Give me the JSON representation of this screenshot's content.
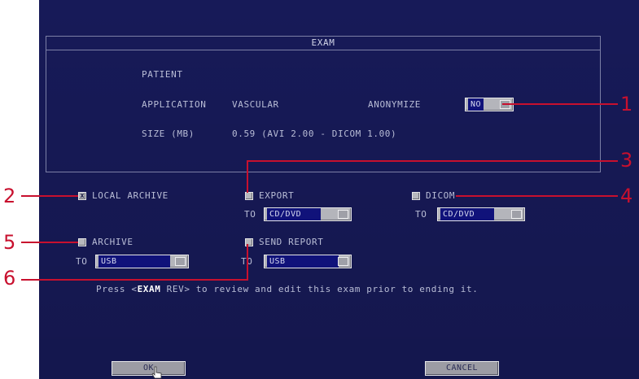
{
  "exam": {
    "title": "EXAM",
    "patient_label": "PATIENT",
    "application_label": "APPLICATION",
    "application_value": "VASCULAR",
    "anonymize_label": "ANONYMIZE",
    "anonymize_value": "NO",
    "size_label": "SIZE (MB)",
    "size_value": "0.59 (AVI 2.00 - DICOM 1.00)"
  },
  "options": {
    "local_archive": {
      "label": "LOCAL ARCHIVE",
      "checked": true,
      "mark": "x"
    },
    "export": {
      "label": "EXPORT",
      "checked": false,
      "to_label": "TO",
      "to_value": "CD/DVD"
    },
    "dicom": {
      "label": "DICOM",
      "checked": false,
      "to_label": "TO",
      "to_value": "CD/DVD"
    },
    "archive": {
      "label": "ARCHIVE",
      "checked": false,
      "to_label": "TO",
      "to_value": "USB"
    },
    "send_report": {
      "label": "SEND REPORT",
      "checked": false,
      "to_label": "TO",
      "to_value": "USB"
    }
  },
  "hint": {
    "before": "Press <",
    "key": "EXAM",
    "after": " REV> to review and edit this exam prior to ending it."
  },
  "buttons": {
    "ok": "OK",
    "cancel": "CANCEL"
  },
  "callouts": [
    "1",
    "2",
    "3",
    "4",
    "5",
    "6"
  ],
  "colors": {
    "screen_bg": "#171a58",
    "callout": "#c8102e",
    "text": "#b9bdd6"
  }
}
